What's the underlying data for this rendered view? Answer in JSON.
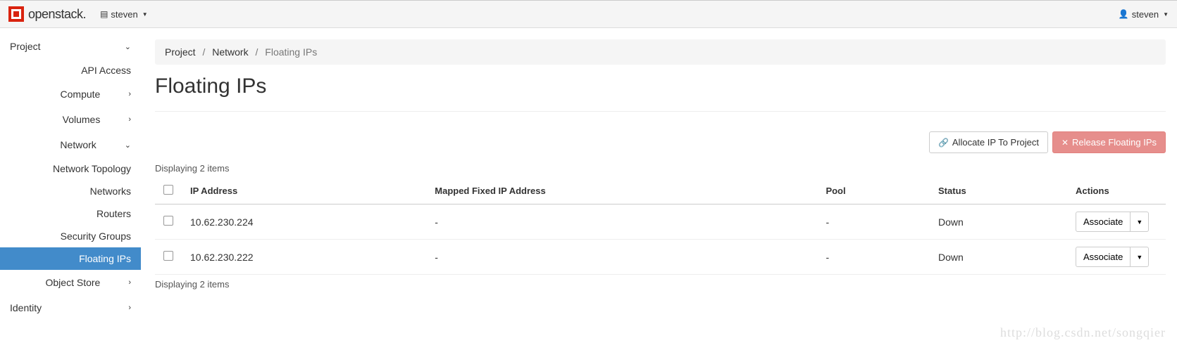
{
  "header": {
    "brand": "openstack.",
    "project_selector": "steven",
    "user_menu": "steven"
  },
  "sidebar": {
    "top_items": [
      {
        "label": "Project",
        "expanded": true
      }
    ],
    "project_children": [
      {
        "label": "API Access",
        "type": "link"
      },
      {
        "label": "Compute",
        "type": "group",
        "chev": "right"
      },
      {
        "label": "Volumes",
        "type": "group",
        "chev": "right"
      },
      {
        "label": "Network",
        "type": "group",
        "chev": "down"
      }
    ],
    "network_children": [
      {
        "label": "Network Topology"
      },
      {
        "label": "Networks"
      },
      {
        "label": "Routers"
      },
      {
        "label": "Security Groups"
      },
      {
        "label": "Floating IPs",
        "active": true
      }
    ],
    "after_network": [
      {
        "label": "Object Store",
        "type": "group",
        "chev": "right"
      }
    ],
    "other_top": [
      {
        "label": "Identity",
        "chev": "right"
      }
    ]
  },
  "breadcrumb": {
    "items": [
      "Project",
      "Network",
      "Floating IPs"
    ]
  },
  "page": {
    "title": "Floating IPs",
    "display_top": "Displaying 2 items",
    "display_bottom": "Displaying 2 items"
  },
  "actions": {
    "allocate": "Allocate IP To Project",
    "release": "Release Floating IPs"
  },
  "table": {
    "headers": {
      "ip": "IP Address",
      "mapped": "Mapped Fixed IP Address",
      "pool": "Pool",
      "status": "Status",
      "actions": "Actions"
    },
    "rows": [
      {
        "ip": "10.62.230.224",
        "mapped": "-",
        "pool": "-",
        "status": "Down",
        "action": "Associate"
      },
      {
        "ip": "10.62.230.222",
        "mapped": "-",
        "pool": "-",
        "status": "Down",
        "action": "Associate"
      }
    ]
  },
  "watermark": "http://blog.csdn.net/songqier"
}
